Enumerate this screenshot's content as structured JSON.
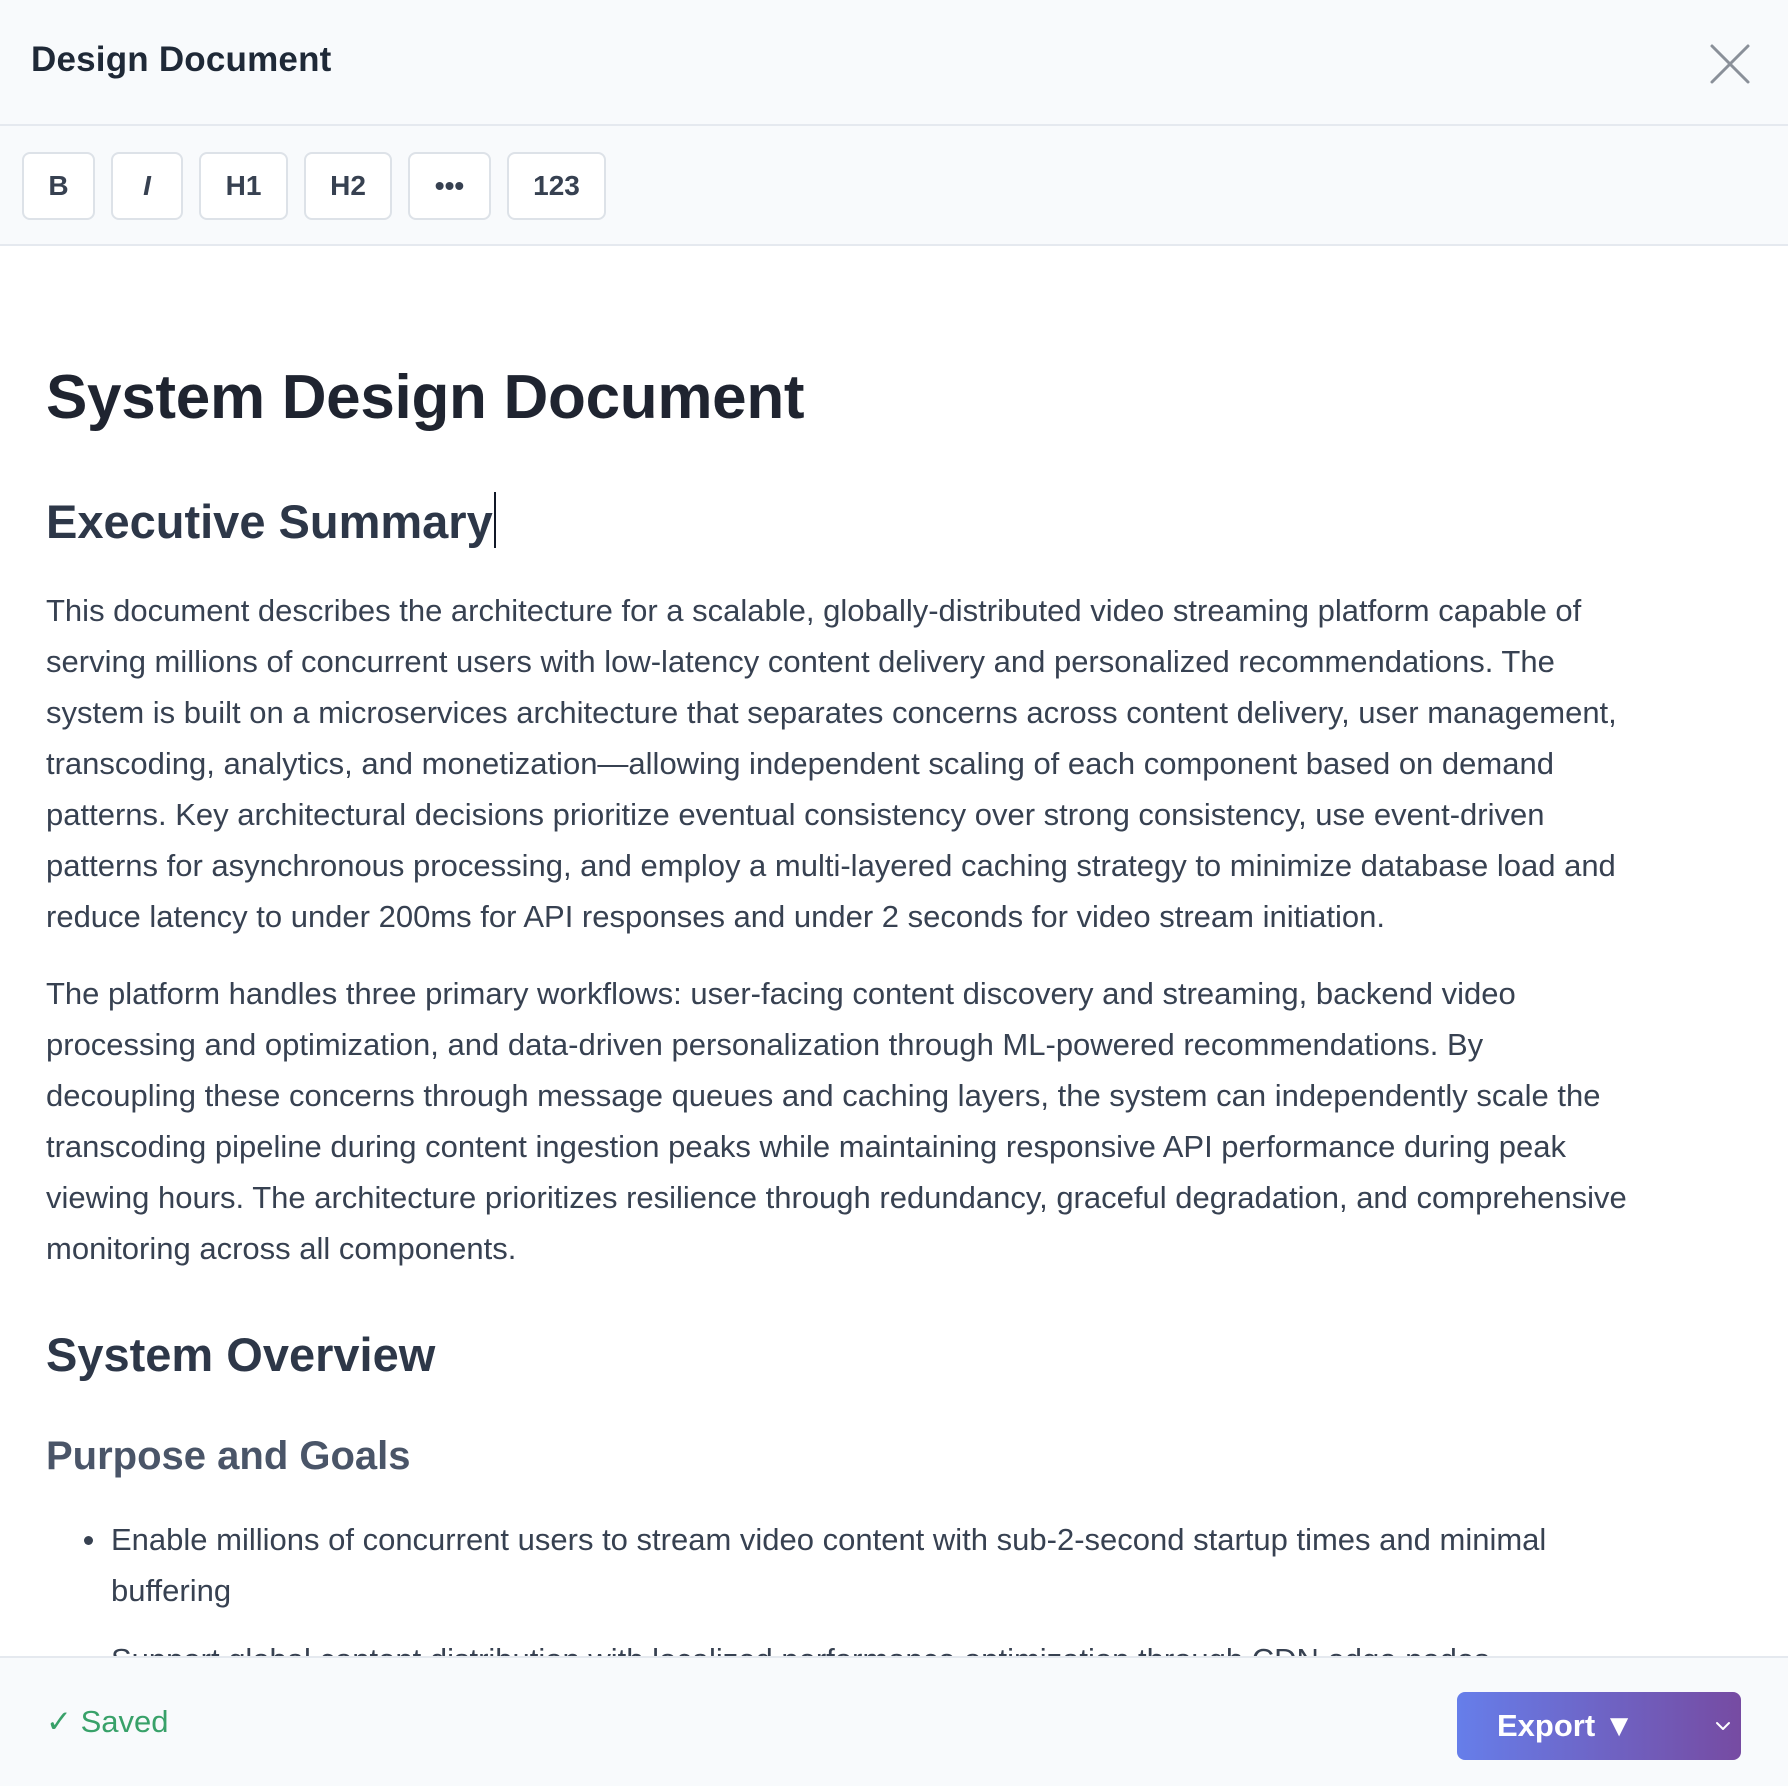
{
  "header": {
    "title": "Design Document"
  },
  "toolbar": {
    "buttons": [
      {
        "label": "B"
      },
      {
        "label": "I"
      },
      {
        "label": "H1"
      },
      {
        "label": "H2"
      },
      {
        "label": "•••"
      },
      {
        "label": "123"
      }
    ]
  },
  "document": {
    "title": "System Design Document",
    "sections": [
      {
        "heading": "Executive Summary",
        "paragraphs": [
          [
            "This document describes the architecture for a scalable, globally-distributed video streaming platform capable of",
            "serving millions of concurrent users with low-latency content delivery and personalized recommendations. The",
            "system is built on a microservices architecture that separates concerns across content delivery, user management,",
            "transcoding, analytics, and monetization—allowing independent scaling of each component based on demand",
            "patterns. Key architectural decisions prioritize eventual consistency over strong consistency, use event-driven",
            "patterns for asynchronous processing, and employ a multi-layered caching strategy to minimize database load and",
            "reduce latency to under 200ms for API responses and under 2 seconds for video stream initiation."
          ],
          [
            "The platform handles three primary workflows: user-facing content discovery and streaming, backend video",
            "processing and optimization, and data-driven personalization through ML-powered recommendations. By",
            "decoupling these concerns through message queues and caching layers, the system can independently scale the",
            "transcoding pipeline during content ingestion peaks while maintaining responsive API performance during peak",
            "viewing hours. The architecture prioritizes resilience through redundancy, graceful degradation, and comprehensive",
            "monitoring across all components."
          ]
        ]
      },
      {
        "heading": "System Overview",
        "subheading": "Purpose and Goals",
        "bullets": [
          [
            "Enable millions of concurrent users to stream video content with sub-2-second startup times and minimal",
            "buffering"
          ],
          [
            "Support global content distribution with localized performance optimization through CDN edge nodes"
          ]
        ]
      }
    ]
  },
  "footer": {
    "status": "✓ Saved",
    "export_label": "Export ▼"
  },
  "colors": {
    "saved_green": "#38a169",
    "export_gradient_start": "#667eea",
    "export_gradient_end": "#764ba2"
  },
  "icons": {
    "close": "close-icon",
    "export_dropdown": "chevron-down-icon"
  }
}
